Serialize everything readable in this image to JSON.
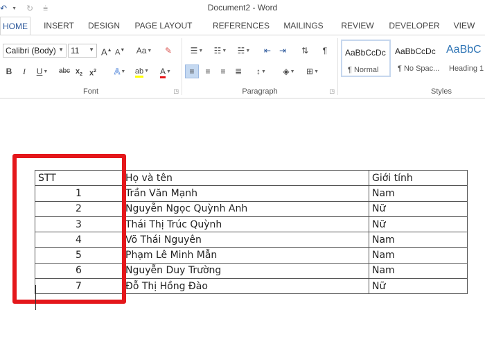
{
  "window": {
    "title": "Document2 - Word"
  },
  "qat": {
    "save_icon": "save-icon",
    "undo_icon": "undo-icon",
    "redo_icon": "redo-icon"
  },
  "tabs": [
    {
      "label": "HOME",
      "active": true
    },
    {
      "label": "INSERT"
    },
    {
      "label": "DESIGN"
    },
    {
      "label": "PAGE LAYOUT"
    },
    {
      "label": "REFERENCES"
    },
    {
      "label": "MAILINGS"
    },
    {
      "label": "REVIEW"
    },
    {
      "label": "DEVELOPER"
    },
    {
      "label": "VIEW"
    }
  ],
  "font_group": {
    "label": "Font",
    "font_name": "Calibri (Body)",
    "font_size": "11",
    "grow": "A",
    "shrink": "A",
    "change_case": "Aa",
    "bold": "B",
    "italic": "I",
    "underline": "U",
    "strike": "abc",
    "subscript": "x",
    "subscript_mark": "2",
    "superscript": "x",
    "superscript_mark": "2",
    "text_effects": "A",
    "highlight": "ab",
    "font_color": "A"
  },
  "paragraph_group": {
    "label": "Paragraph"
  },
  "styles_group": {
    "label": "Styles",
    "items": [
      {
        "sample": "AaBbCcDc",
        "name": "¶ Normal"
      },
      {
        "sample": "AaBbCcDc",
        "name": "¶ No Spac..."
      },
      {
        "sample": "AaBbC",
        "name": "Heading 1"
      }
    ]
  },
  "table": {
    "headers": [
      "STT",
      "Họ và tên",
      "Giới tính"
    ],
    "rows": [
      [
        "1",
        "Trần Văn Mạnh",
        "Nam"
      ],
      [
        "2",
        "Nguyễn Ngọc Quỳnh Anh",
        "Nữ"
      ],
      [
        "3",
        "Thái Thị Trúc Quỳnh",
        "Nữ"
      ],
      [
        "4",
        "Võ  Thái Nguyên",
        "Nam"
      ],
      [
        "5",
        "Phạm Lê Minh Mẫn",
        "Nam"
      ],
      [
        "6",
        "Nguyễn Duy Trường",
        "Nam"
      ],
      [
        "7",
        "Đỗ Thị Hồng Đào",
        "Nữ"
      ]
    ]
  },
  "colors": {
    "accent": "#2b579a",
    "highlight_box": "#e4171b"
  }
}
